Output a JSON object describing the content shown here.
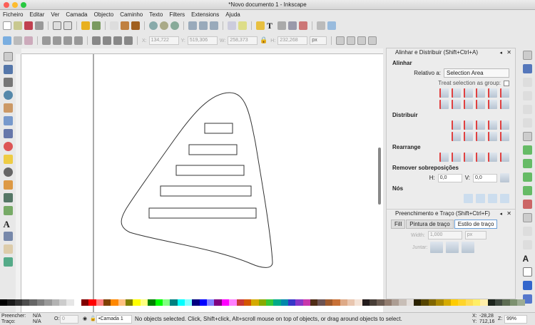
{
  "window": {
    "title": "*Novo documento 1 - Inkscape"
  },
  "menu": [
    "Ficheiro",
    "Editar",
    "Ver",
    "Camada",
    "Objecto",
    "Caminho",
    "Texto",
    "Filters",
    "Extensions",
    "Ajuda"
  ],
  "toolbar": {
    "x_label": "X:",
    "x": "134,722",
    "y_label": "Y:",
    "y": "519,306",
    "w_label": "W:",
    "w": "258,373",
    "h_label": "H:",
    "h": "232,268",
    "unit": "px"
  },
  "align_panel": {
    "title": "Alinhar e Distribuir (Shift+Ctrl+A)",
    "align": "Alinhar",
    "relative_label": "Relativo a:",
    "relative_value": "Selection Area",
    "treat_group": "Treat selection as group:",
    "distribute": "Distribuir",
    "rearrange": "Rearrange",
    "remove_overlap": "Remover sobreposições",
    "h_label": "H:",
    "h_value": "0,0",
    "v_label": "V:",
    "v_value": "0,0",
    "nodes": "Nós"
  },
  "fill_panel": {
    "title": "Preenchimento e Traço (Shift+Ctrl+F)",
    "tabs": [
      "Fill",
      "Pintura de traço",
      "Estilo de traço"
    ],
    "width_label": "Width:",
    "width_value": "1,000",
    "width_unit": "px",
    "join_label": "Juntar:"
  },
  "status": {
    "fill_label": "Preencher:",
    "fill_value": "N/A",
    "stroke_label": "Traço:",
    "stroke_value": "N/A",
    "opacity_label": "O:",
    "opacity_value": "0",
    "layer": "•Camada 1",
    "message": "No objects selected. Click, Shift+click, Alt+scroll mouse on top of objects, or drag around objects to select.",
    "cursor_x_label": "X:",
    "cursor_x": "-28,28",
    "cursor_y_label": "Y:",
    "cursor_y": "712,16",
    "zoom_label": "Z:",
    "zoom": "99%"
  },
  "colors": {
    "accent": "#3a7bd5",
    "page_border": "#555555"
  }
}
